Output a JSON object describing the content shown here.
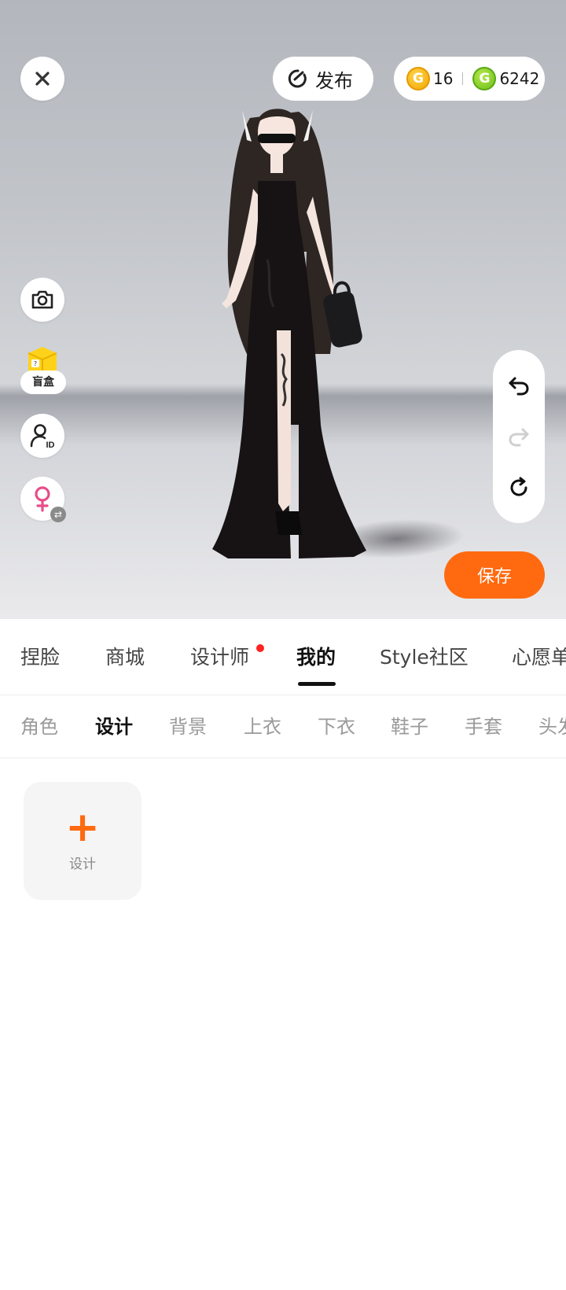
{
  "topbar": {
    "publish_label": "发布",
    "gold_coins": "16",
    "green_coins": "6242",
    "gold_coin_symbol": "G",
    "green_coin_symbol": "G"
  },
  "side": {
    "blind_box_label": "盲盒",
    "id_label": "ID"
  },
  "actions": {
    "save_label": "保存"
  },
  "tabs": [
    {
      "label": "捏脸"
    },
    {
      "label": "商城"
    },
    {
      "label": "设计师"
    },
    {
      "label": "我的"
    },
    {
      "label": "Style社区"
    },
    {
      "label": "心愿单"
    }
  ],
  "active_tab": "我的",
  "subtabs": [
    {
      "label": "角色"
    },
    {
      "label": "设计"
    },
    {
      "label": "背景"
    },
    {
      "label": "上衣"
    },
    {
      "label": "下衣"
    },
    {
      "label": "鞋子"
    },
    {
      "label": "手套"
    },
    {
      "label": "头发"
    }
  ],
  "active_subtab": "设计",
  "content": {
    "add_design_label": "设计"
  },
  "colors": {
    "accent": "#ff6a10",
    "notification_dot": "#ff2222",
    "gold_coin": "#f2a800",
    "green_coin": "#6cbf1b"
  }
}
